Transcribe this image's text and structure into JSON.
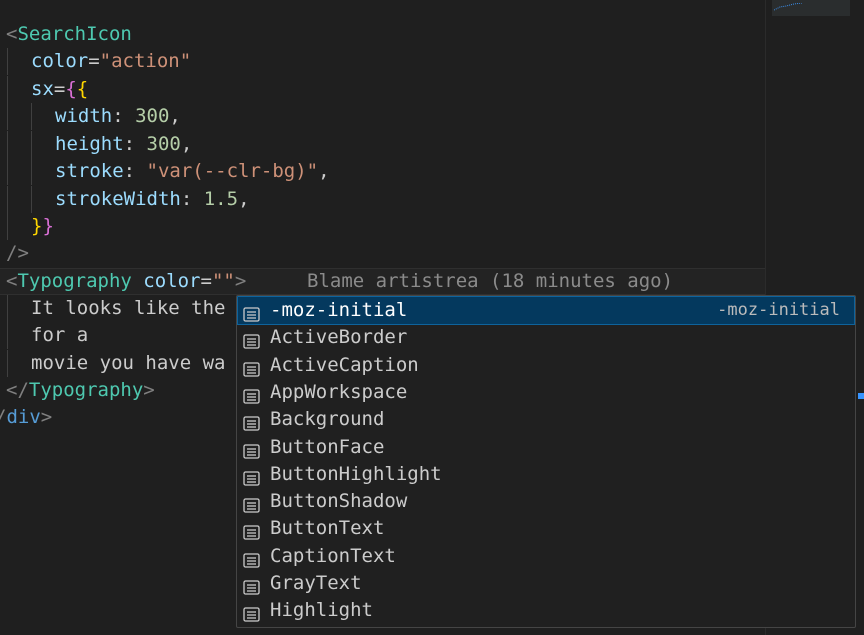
{
  "editor": {
    "lines": [
      {
        "parts": [
          "<",
          "SearchIcon"
        ]
      },
      {
        "parts": [
          "color",
          "=",
          "\"action\""
        ]
      },
      {
        "parts": [
          "sx",
          "=",
          "{",
          "{"
        ]
      },
      {
        "parts": [
          "width",
          ": ",
          "300",
          ","
        ]
      },
      {
        "parts": [
          "height",
          ": ",
          "300",
          ","
        ]
      },
      {
        "parts": [
          "stroke",
          ": ",
          "\"var(--clr-bg)\"",
          ","
        ]
      },
      {
        "parts": [
          "strokeWidth",
          ": ",
          "1.5",
          ","
        ]
      },
      {
        "parts": [
          "}",
          "}"
        ]
      },
      {
        "parts": [
          "/>"
        ]
      },
      {
        "parts": [
          "<",
          "Typography",
          " ",
          "color",
          "=",
          "\"\"",
          ">"
        ],
        "blame": "Blame artistrea (18 minutes ago)"
      },
      {
        "parts": [
          "It looks like the"
        ]
      },
      {
        "parts": [
          "for a"
        ]
      },
      {
        "parts": [
          "movie you have wa"
        ]
      },
      {
        "parts": [
          "</",
          "Typography",
          ">"
        ]
      },
      {
        "parts": [
          "/",
          "div",
          ">"
        ]
      }
    ]
  },
  "suggest": {
    "items": [
      {
        "label": "-moz-initial",
        "detail": "-moz-initial",
        "selected": true
      },
      {
        "label": "ActiveBorder"
      },
      {
        "label": "ActiveCaption"
      },
      {
        "label": "AppWorkspace"
      },
      {
        "label": "Background"
      },
      {
        "label": "ButtonFace"
      },
      {
        "label": "ButtonHighlight"
      },
      {
        "label": "ButtonShadow"
      },
      {
        "label": "ButtonText"
      },
      {
        "label": "CaptionText"
      },
      {
        "label": "GrayText"
      },
      {
        "label": "Highlight"
      }
    ],
    "icon": "enum-value-icon"
  },
  "colors": {
    "background": "#1f1f1f",
    "selection": "#04395e",
    "tag": "#4ec9b0",
    "attribute": "#9cdcfe",
    "string": "#ce9178",
    "number": "#b5cea8"
  }
}
